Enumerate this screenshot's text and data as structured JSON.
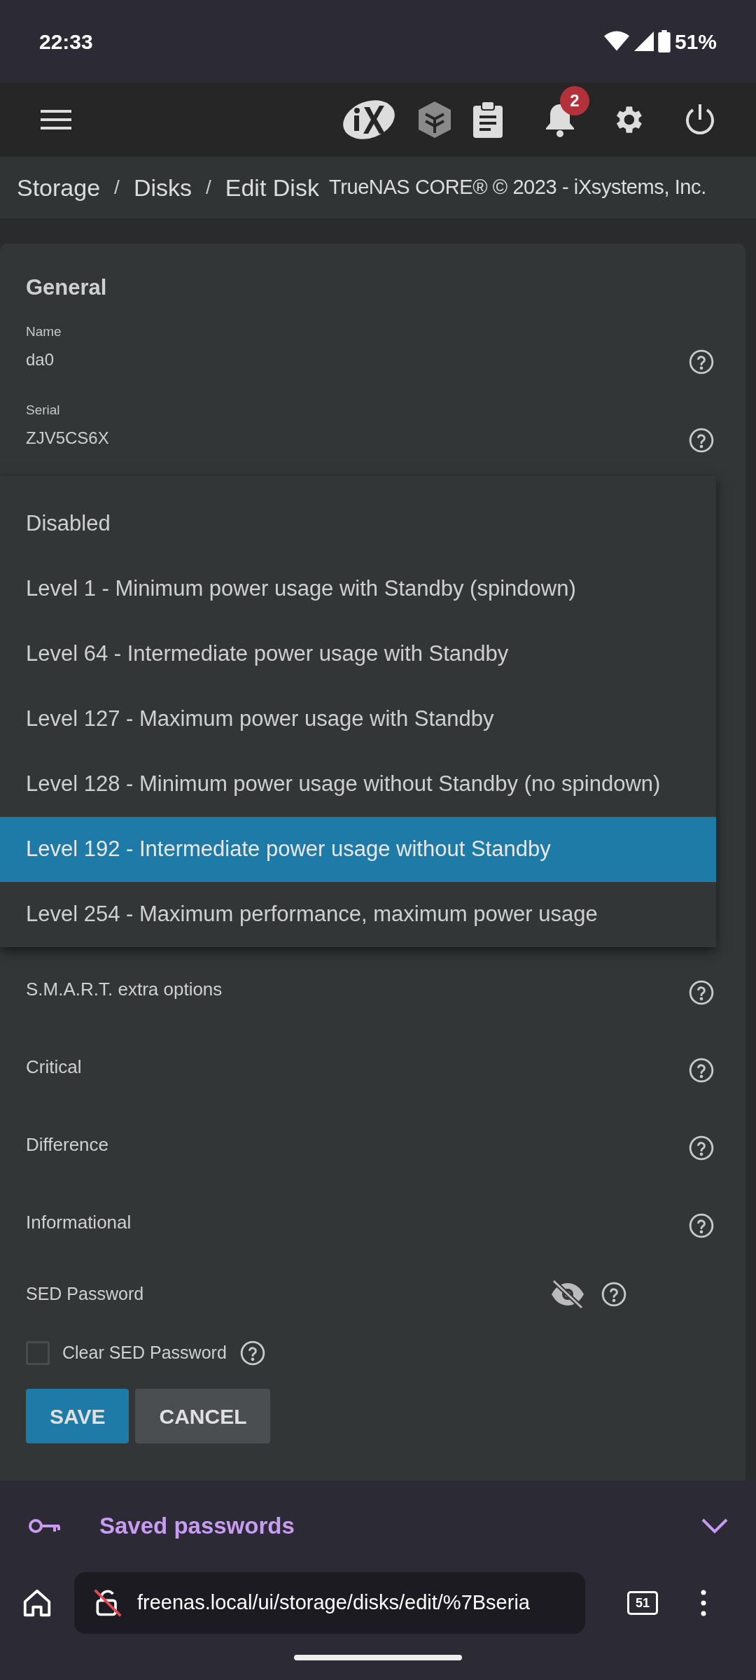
{
  "status_bar": {
    "time": "22:33",
    "battery": "51%"
  },
  "toolbar": {
    "notification_count": "2"
  },
  "breadcrumb": [
    "Storage",
    "Disks",
    "Edit Disk"
  ],
  "breadcrumb_separators": [
    "/",
    "/"
  ],
  "copyright": "TrueNAS CORE® © 2023 - iXsystems, Inc.",
  "section_title": "General",
  "fields": [
    {
      "label": "Name",
      "value": "da0"
    },
    {
      "label": "Serial",
      "value": "ZJV5CS6X"
    }
  ],
  "dropdown_options": [
    {
      "label": "Disabled",
      "selected": false
    },
    {
      "label": "Level 1 - Minimum power usage with Standby (spindown)",
      "selected": false
    },
    {
      "label": "Level 64 - Intermediate power usage with Standby",
      "selected": false
    },
    {
      "label": "Level 127 - Maximum power usage with Standby",
      "selected": false
    },
    {
      "label": "Level 128 - Minimum power usage without Standby (no spindown)",
      "selected": false
    },
    {
      "label": "Level 192 - Intermediate power usage without Standby",
      "selected": true
    },
    {
      "label": "Level 254 - Maximum performance, maximum power usage",
      "selected": false
    }
  ],
  "option_fields": [
    {
      "label": "S.M.A.R.T. extra options"
    },
    {
      "label": "Critical"
    },
    {
      "label": "Difference"
    },
    {
      "label": "Informational"
    }
  ],
  "sed_password": {
    "label": "SED Password"
  },
  "clear_sed": {
    "label": "Clear SED Password",
    "checked": false
  },
  "buttons": [
    {
      "label": "SAVE",
      "kind": "primary"
    },
    {
      "label": "CANCEL",
      "kind": "secondary"
    }
  ],
  "saved_passwords": {
    "label": "Saved passwords"
  },
  "browser": {
    "url": "freenas.local/ui/storage/disks/edit/%7Bseria",
    "tab_count": "51"
  }
}
